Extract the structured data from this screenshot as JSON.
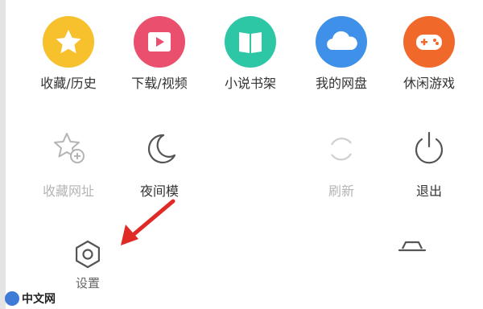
{
  "menu": {
    "top_items": [
      {
        "label": "收藏/历史",
        "icon": "star-icon",
        "color": "#F7C02D"
      },
      {
        "label": "下载/视频",
        "icon": "play-icon",
        "color": "#EB4F6E"
      },
      {
        "label": "小说书架",
        "icon": "book-icon",
        "color": "#2DC7A6"
      },
      {
        "label": "我的网盘",
        "icon": "cloud-icon",
        "color": "#3E90E8"
      },
      {
        "label": "休闲游戏",
        "icon": "gamepad-icon",
        "color": "#F0682A"
      }
    ],
    "second_row": [
      {
        "label": "收藏网址",
        "icon": "star-add-icon",
        "disabled": true
      },
      {
        "label": "夜间模",
        "icon": "moon-icon",
        "disabled": false
      },
      {
        "label": "刷新",
        "icon": "refresh-icon",
        "disabled": true
      },
      {
        "label": "退出",
        "icon": "power-icon",
        "disabled": false
      }
    ],
    "bottom": {
      "settings_label": "设置",
      "settings_icon": "gear-icon",
      "collapse_icon": "collapse-icon"
    }
  },
  "watermark": {
    "text": "中文网",
    "logo": "php-logo-icon"
  },
  "colors": {
    "text": "#333333",
    "muted": "#B4B4B4",
    "outline_dark": "#555555",
    "arrow": "#E02A26"
  }
}
